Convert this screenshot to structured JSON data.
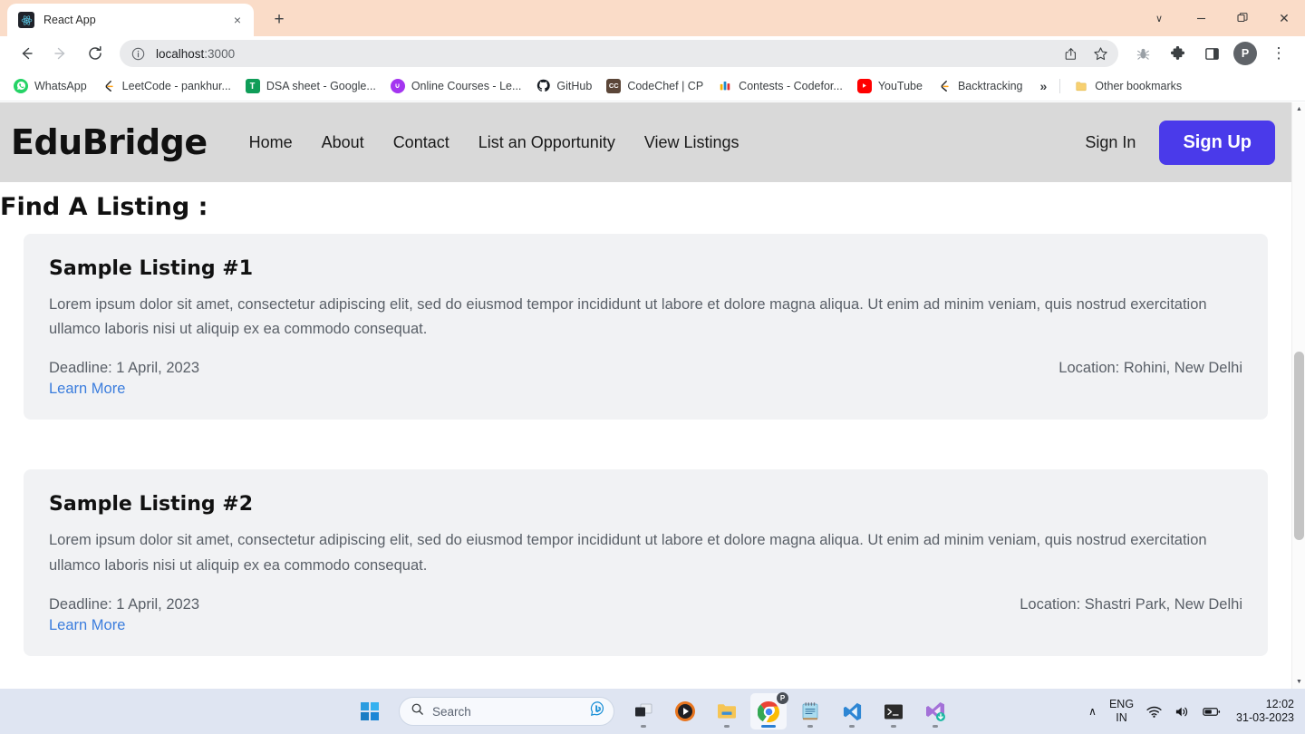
{
  "browser": {
    "tab": {
      "title": "React App",
      "favicon": "react-icon",
      "close_label": "×"
    },
    "newtab_label": "+",
    "window_controls": {
      "chevron": "∨",
      "minimize": "—",
      "maximize": "❐",
      "close": "✕"
    },
    "toolbar": {
      "back": "←",
      "forward": "→",
      "reload": "⟳",
      "url_host": "localhost",
      "url_port": ":3000",
      "info_icon": "ⓘ",
      "share_icon": "share-icon",
      "bookmark_icon": "☆",
      "bug_icon": "bug-icon",
      "extensions_icon": "puzzle-icon",
      "sidepanel_icon": "side-panel-icon",
      "profile_initial": "P",
      "menu_icon": "⋮"
    },
    "bookmarks": [
      {
        "label": "WhatsApp",
        "icon": "whatsapp-icon",
        "color": "#25d366"
      },
      {
        "label": "LeetCode - pankhur...",
        "icon": "leetcode-icon",
        "color": "#ffa116"
      },
      {
        "label": "DSA sheet - Google...",
        "icon": "google-sheets-icon",
        "color": "#0f9d58"
      },
      {
        "label": "Online Courses - Le...",
        "icon": "udemy-icon",
        "color": "#a435f0"
      },
      {
        "label": "GitHub",
        "icon": "github-icon",
        "color": "#161b22"
      },
      {
        "label": "CodeChef | CP",
        "icon": "codechef-icon",
        "color": "#5b4638"
      },
      {
        "label": "Contests - Codefor...",
        "icon": "codeforces-icon",
        "color": "#1f8acb"
      },
      {
        "label": "YouTube",
        "icon": "youtube-icon",
        "color": "#ff0000"
      },
      {
        "label": "Backtracking",
        "icon": "leetcode-icon",
        "color": "#ffa116"
      }
    ],
    "bookmarks_overflow": "»",
    "other_bookmarks": {
      "label": "Other bookmarks",
      "icon": "folder-icon"
    }
  },
  "site": {
    "navbar": {
      "brand": "EduBridge",
      "links": [
        {
          "label": "Home"
        },
        {
          "label": "About"
        },
        {
          "label": "Contact"
        },
        {
          "label": "List an Opportunity"
        },
        {
          "label": "View Listings"
        }
      ],
      "sign_in": "Sign In",
      "sign_up": "Sign Up",
      "sign_up_color": "#4a3aea",
      "background_color": "#d9d9d9"
    },
    "page_title": "Find A Listing :",
    "listings": [
      {
        "title": "Sample Listing #1",
        "description": "Lorem ipsum dolor sit amet, consectetur adipiscing elit, sed do eiusmod tempor incididunt ut labore et dolore magna aliqua. Ut enim ad minim veniam, quis nostrud exercitation ullamco laboris nisi ut aliquip ex ea commodo consequat.",
        "deadline": "Deadline: 1 April, 2023",
        "learn_more": "Learn More",
        "location": "Location: Rohini, New Delhi"
      },
      {
        "title": "Sample Listing #2",
        "description": "Lorem ipsum dolor sit amet, consectetur adipiscing elit, sed do eiusmod tempor incididunt ut labore et dolore magna aliqua. Ut enim ad minim veniam, quis nostrud exercitation ullamco laboris nisi ut aliquip ex ea commodo consequat.",
        "deadline": "Deadline: 1 April, 2023",
        "learn_more": "Learn More",
        "location": "Location: Shastri Park, New Delhi"
      }
    ],
    "scrollbar": {
      "up": "▲",
      "down": "▼"
    }
  },
  "taskbar": {
    "start": "start-icon",
    "search_placeholder": "Search",
    "search_icon": "search-icon",
    "bing_icon": "bing-chat-icon",
    "apps": [
      {
        "name": "task-view-icon"
      },
      {
        "name": "media-player-icon"
      },
      {
        "name": "file-explorer-icon"
      },
      {
        "name": "google-chrome-icon"
      },
      {
        "name": "notepad-icon"
      },
      {
        "name": "vs-code-icon"
      },
      {
        "name": "terminal-icon"
      },
      {
        "name": "visual-studio-icon"
      }
    ],
    "tray": {
      "overflow": "∧",
      "language_line1": "ENG",
      "language_line2": "IN",
      "wifi_icon": "wifi-icon",
      "volume_icon": "volume-icon",
      "battery_icon": "battery-icon",
      "time": "12:02",
      "date": "31-03-2023"
    }
  }
}
